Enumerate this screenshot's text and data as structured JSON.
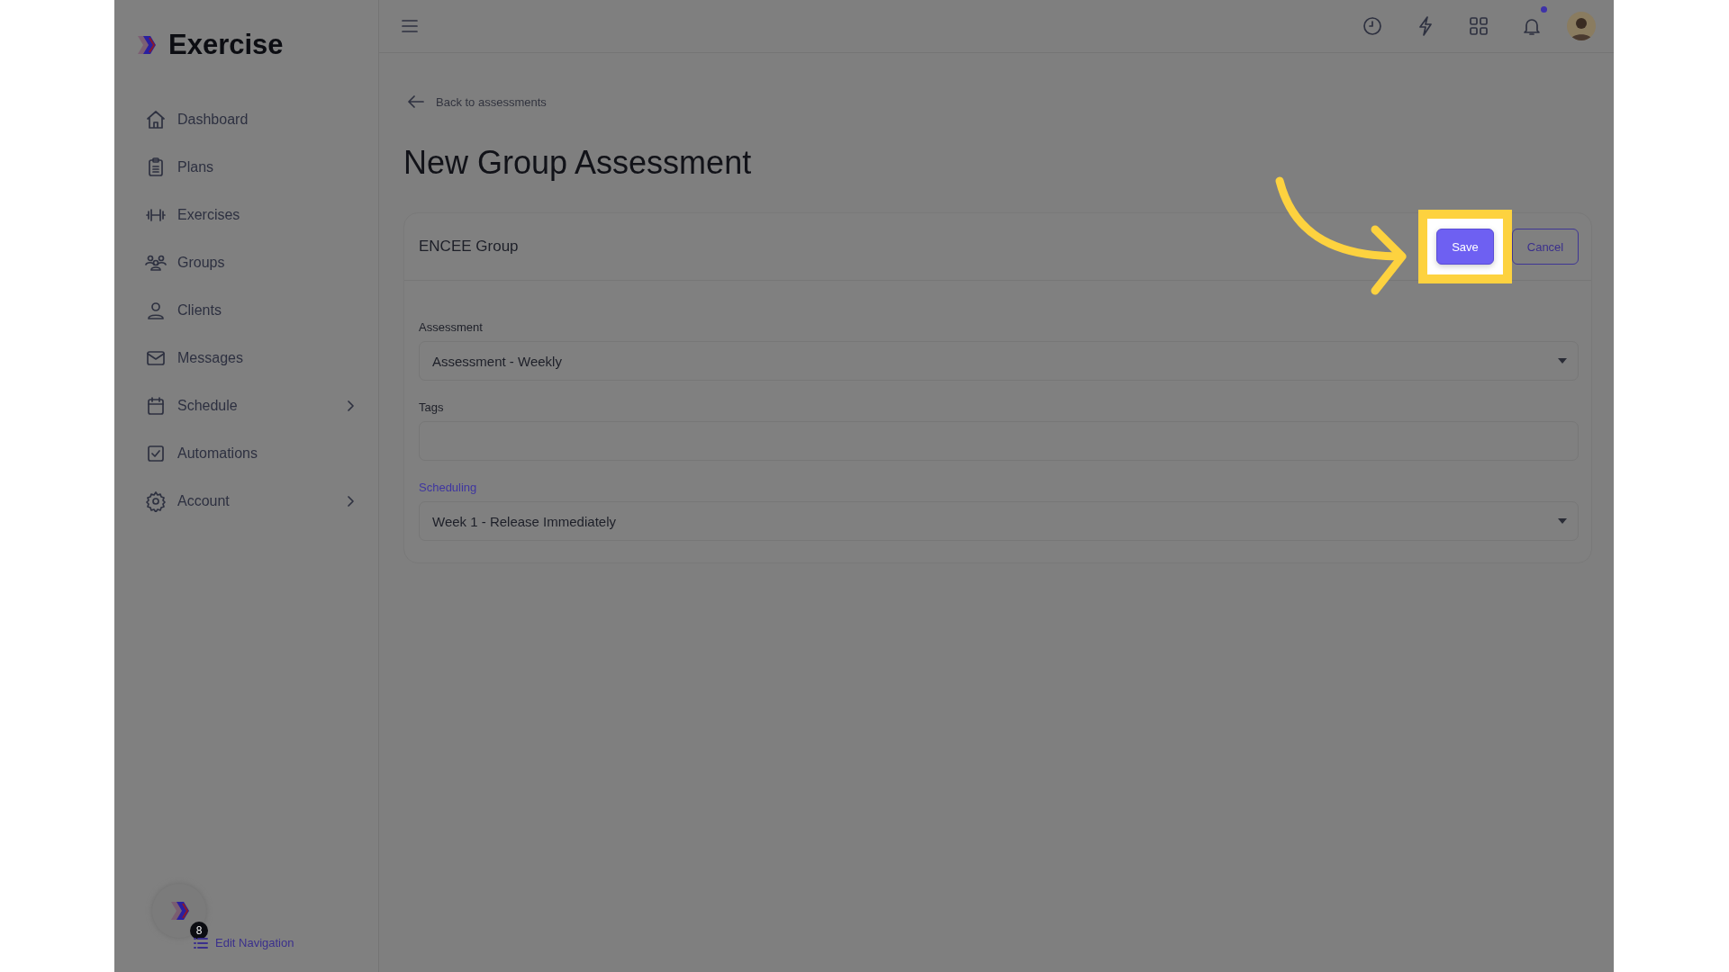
{
  "brand": {
    "name": "Exercise"
  },
  "sidebar": {
    "items": [
      {
        "label": "Dashboard",
        "expandable": false
      },
      {
        "label": "Plans",
        "expandable": false
      },
      {
        "label": "Exercises",
        "expandable": false
      },
      {
        "label": "Groups",
        "expandable": false
      },
      {
        "label": "Clients",
        "expandable": false
      },
      {
        "label": "Messages",
        "expandable": false
      },
      {
        "label": "Schedule",
        "expandable": true
      },
      {
        "label": "Automations",
        "expandable": false
      },
      {
        "label": "Account",
        "expandable": true
      }
    ],
    "footer": {
      "badge": "8",
      "link": "Edit Navigation"
    }
  },
  "header": {
    "notifications_unread": true
  },
  "page": {
    "back_link": "Back to assessments",
    "title": "New Group Assessment"
  },
  "card": {
    "title": "ENCEE Group",
    "buttons": [
      {
        "label": "Save",
        "kind": "primary",
        "highlighted": true
      },
      {
        "label": "Cancel",
        "kind": "outline",
        "highlighted": false
      }
    ],
    "fields": [
      {
        "label": "Assessment",
        "kind": "select",
        "value": "Assessment - Weekly",
        "accent": false
      },
      {
        "label": "Tags",
        "kind": "text",
        "accent": false
      },
      {
        "label": "Scheduling",
        "kind": "select",
        "value": "Week 1 - Release Immediately",
        "accent": true
      }
    ]
  }
}
